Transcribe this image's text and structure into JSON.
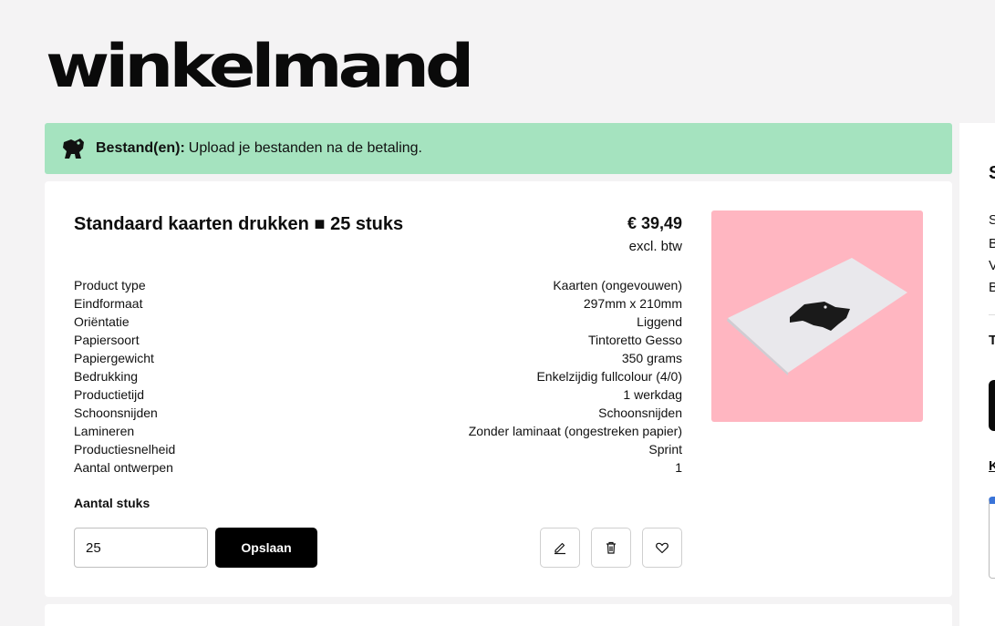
{
  "page": {
    "title": "winkelmand"
  },
  "notice": {
    "label": "Bestand(en):",
    "text": "Upload je bestanden na de betaling."
  },
  "product": {
    "name": "Standaard kaarten drukken ■ 25 stuks",
    "price": "€ 39,49",
    "vat_note": "excl. btw",
    "specs": [
      {
        "label": "Product type",
        "value": "Kaarten (ongevouwen)"
      },
      {
        "label": "Eindformaat",
        "value": "297mm x 210mm"
      },
      {
        "label": "Oriëntatie",
        "value": "Liggend"
      },
      {
        "label": "Papiersoort",
        "value": "Tintoretto Gesso"
      },
      {
        "label": "Papiergewicht",
        "value": "350 grams"
      },
      {
        "label": "Bedrukking",
        "value": "Enkelzijdig fullcolour (4/0)"
      },
      {
        "label": "Productietijd",
        "value": "1 werkdag"
      },
      {
        "label": "Schoonsnijden",
        "value": "Schoonsnijden"
      },
      {
        "label": "Lamineren",
        "value": "Zonder laminaat (ongestreken papier)"
      },
      {
        "label": "Productiesnelheid",
        "value": "Sprint"
      },
      {
        "label": "Aantal ontwerpen",
        "value": "1"
      }
    ],
    "quantity_label": "Aantal stuks",
    "quantity_value": "25",
    "save_label": "Opslaan"
  },
  "sidebar": {
    "letters": [
      "S",
      "S",
      "B",
      "V",
      "B",
      "T",
      "K"
    ]
  },
  "colors": {
    "notice_bg": "#a5e3bf",
    "image_bg": "#ffb6c1",
    "accent_blue": "#3a74d8"
  },
  "icons": [
    "elephant-icon",
    "pencil-icon",
    "trash-icon",
    "heart-icon"
  ]
}
